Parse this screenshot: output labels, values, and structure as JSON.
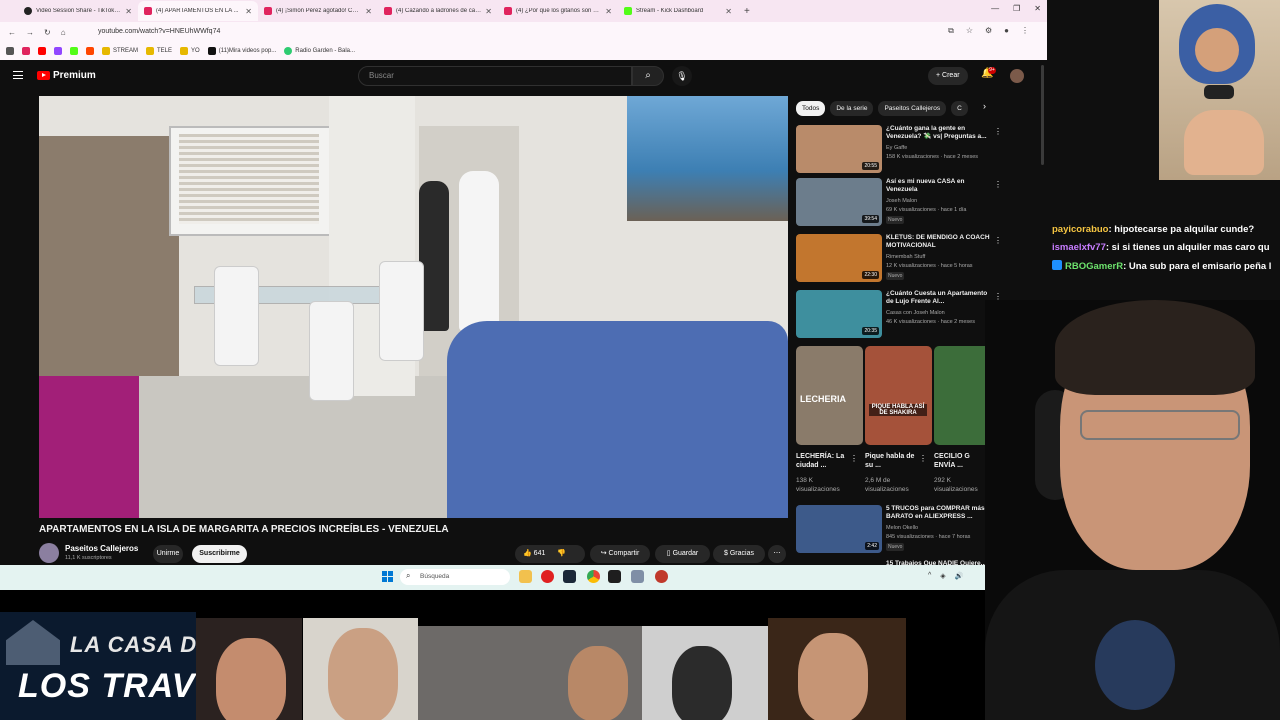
{
  "browser": {
    "tabs": [
      {
        "label": "Video Session Share - TikTok St...",
        "icon": "tiktok"
      },
      {
        "label": "(4) APARTAMENTOS EN LA ...",
        "icon": "youtube"
      },
      {
        "label": "(4) ¡Simón Pérez agotado! Con...",
        "icon": "youtube"
      },
      {
        "label": "(4) Cazando a ladrones de carr...",
        "icon": "youtube"
      },
      {
        "label": "(4) ¿Por qué los gitanos son oc...",
        "icon": "youtube"
      },
      {
        "label": "Stream - Kick Dashboard",
        "icon": "kick"
      }
    ],
    "url": "youtube.com/watch?v=HNEUhWWfq74",
    "bookmarks": [
      "STREAM",
      "TELE",
      "YO",
      "(11)Mira videos pop...",
      "Radio Garden - Bala..."
    ]
  },
  "youtube": {
    "logo_text": "Premium",
    "search_placeholder": "Buscar",
    "create_label": "Crear",
    "notif_count": "9+",
    "video": {
      "title": "APARTAMENTOS EN LA ISLA DE MARGARITA A PRECIOS INCREÍBLES - VENEZUELA",
      "channel": "Paseitos Callejeros",
      "subscribers": "11,1 K suscriptores",
      "join_label": "Unirme",
      "subscribe_label": "Suscribirme",
      "likes": "641",
      "share_label": "Compartir",
      "save_label": "Guardar",
      "thanks_label": "Gracias"
    },
    "chips": [
      "Todos",
      "De la serie",
      "Paseitos Callejeros",
      "C"
    ],
    "recommendations": [
      {
        "title": "¿Cuánto gana la gente en Venezuela? 💸 vs| Preguntas a...",
        "channel": "Ey Gaffe",
        "meta": "158 K visualizaciones · hace 2 meses",
        "duration": "20:55",
        "badge": "",
        "thumb": "#b98b6a"
      },
      {
        "title": "Así es mi nueva CASA en Venezuela",
        "channel": "Joseh Malon",
        "meta": "69 K visualizaciones · hace 1 día",
        "duration": "39:54",
        "badge": "Nuevo",
        "thumb": "#6c7d8c"
      },
      {
        "title": "KLETUS: DE MENDIGO A COACH MOTIVACIONAL",
        "channel": "Rimembah Stuff",
        "meta": "12 K visualizaciones · hace 5 horas",
        "duration": "22:30",
        "badge": "Nuevo",
        "thumb": "#c2762e"
      },
      {
        "title": "¿Cuánto Cuesta un Apartamento de Lujo Frente Al...",
        "channel": "Casas con Joseh Malon",
        "meta": "46 K visualizaciones · hace 2 meses",
        "duration": "20:35",
        "badge": "",
        "thumb": "#3e8f9e"
      },
      {
        "title": "5 TRUCOS para COMPRAR más BARATO en ALIEXPRESS ...",
        "channel": "Melon Okello",
        "meta": "845 visualizaciones · hace 7 horas",
        "duration": "2:42",
        "badge": "Nuevo",
        "thumb": "#3d5a8a"
      }
    ],
    "shorts": [
      {
        "caption": "LECHERÍA: La ciudad ...",
        "views": "138 K visualizaciones",
        "overlay": "LECHERIA",
        "thumb": "#8a7b6a"
      },
      {
        "caption": "Pique habla de su ...",
        "views": "2,6 M de visualizaciones",
        "overlay": "PIQUE HABLA ASÍ DE SHAKIRA",
        "thumb": "#a5523a"
      },
      {
        "caption": "CECILIO G ENVÍA ...",
        "views": "292 K visualizaciones",
        "overlay": "",
        "thumb": "#3c6d3a"
      }
    ],
    "partial_next": "15 Trabajos Que NADIE Quiere..."
  },
  "taskbar": {
    "search_placeholder": "Búsqueda"
  },
  "chat": [
    {
      "user": "payicorabuo",
      "message": ": hipotecarse pa alquilar cunde?",
      "color": "#f5c542"
    },
    {
      "user": "ismaelxfv77",
      "message": ": si si tienes un alquiler mas caro qu",
      "color": "#c77dff"
    },
    {
      "user": "RBOGamerR",
      "message": ": Una sub para el emisario peña l",
      "color": "#6de36d"
    }
  ],
  "overlay": {
    "brand_line1": "LA CASA DE",
    "brand_line2": "LOS TRAVELOS"
  }
}
